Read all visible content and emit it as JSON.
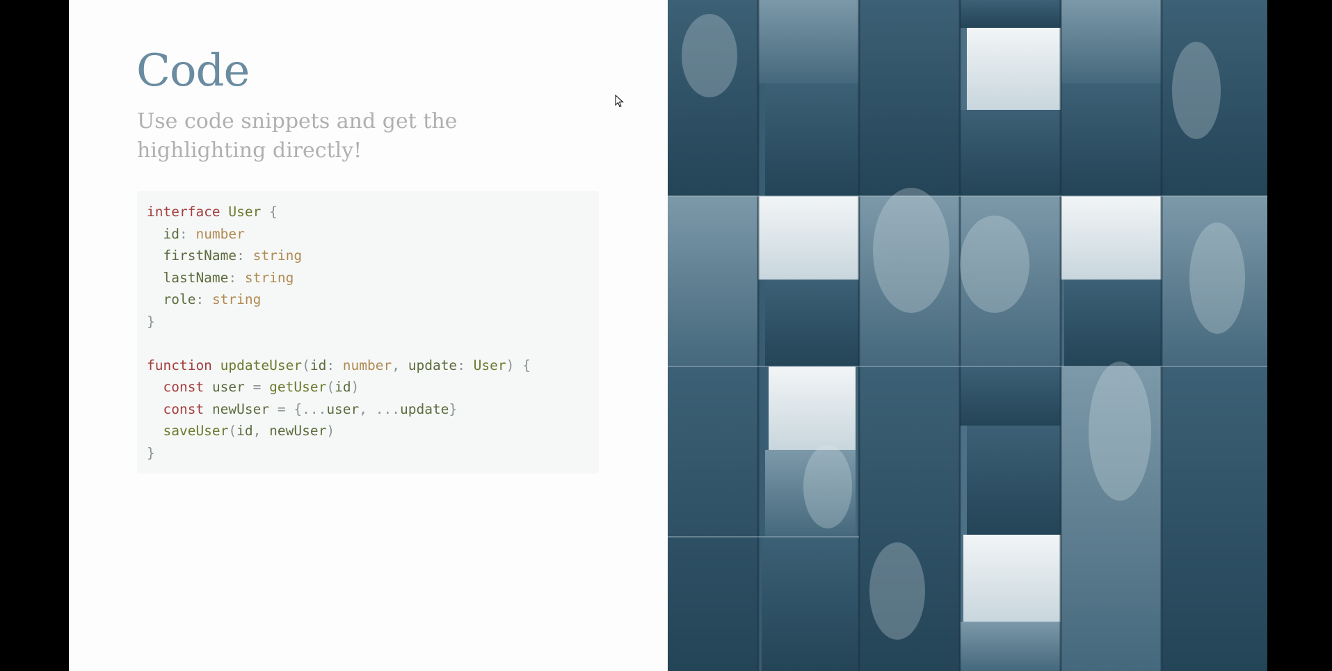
{
  "slide": {
    "title": "Code",
    "subtitle": "Use code snippets and get the highlighting directly!"
  },
  "code": {
    "language": "typescript",
    "lines": [
      [
        {
          "t": "interface",
          "c": "kw"
        },
        {
          "t": " ",
          "c": "plain"
        },
        {
          "t": "User",
          "c": "name"
        },
        {
          "t": " {",
          "c": "punc"
        }
      ],
      [
        {
          "t": "  id",
          "c": "plain"
        },
        {
          "t": ": ",
          "c": "punc"
        },
        {
          "t": "number",
          "c": "type"
        }
      ],
      [
        {
          "t": "  firstName",
          "c": "plain"
        },
        {
          "t": ": ",
          "c": "punc"
        },
        {
          "t": "string",
          "c": "type"
        }
      ],
      [
        {
          "t": "  lastName",
          "c": "plain"
        },
        {
          "t": ": ",
          "c": "punc"
        },
        {
          "t": "string",
          "c": "type"
        }
      ],
      [
        {
          "t": "  role",
          "c": "plain"
        },
        {
          "t": ": ",
          "c": "punc"
        },
        {
          "t": "string",
          "c": "type"
        }
      ],
      [
        {
          "t": "}",
          "c": "punc"
        }
      ],
      [],
      [
        {
          "t": "function",
          "c": "kw"
        },
        {
          "t": " ",
          "c": "plain"
        },
        {
          "t": "updateUser",
          "c": "name"
        },
        {
          "t": "(",
          "c": "punc"
        },
        {
          "t": "id",
          "c": "plain"
        },
        {
          "t": ": ",
          "c": "punc"
        },
        {
          "t": "number",
          "c": "type"
        },
        {
          "t": ", ",
          "c": "punc"
        },
        {
          "t": "update",
          "c": "plain"
        },
        {
          "t": ": ",
          "c": "punc"
        },
        {
          "t": "User",
          "c": "name"
        },
        {
          "t": ") {",
          "c": "punc"
        }
      ],
      [
        {
          "t": "  ",
          "c": "plain"
        },
        {
          "t": "const",
          "c": "kw"
        },
        {
          "t": " ",
          "c": "plain"
        },
        {
          "t": "user",
          "c": "plain"
        },
        {
          "t": " = ",
          "c": "punc"
        },
        {
          "t": "getUser",
          "c": "name"
        },
        {
          "t": "(",
          "c": "punc"
        },
        {
          "t": "id",
          "c": "plain"
        },
        {
          "t": ")",
          "c": "punc"
        }
      ],
      [
        {
          "t": "  ",
          "c": "plain"
        },
        {
          "t": "const",
          "c": "kw"
        },
        {
          "t": " ",
          "c": "plain"
        },
        {
          "t": "newUser",
          "c": "plain"
        },
        {
          "t": " = {...",
          "c": "punc"
        },
        {
          "t": "user",
          "c": "plain"
        },
        {
          "t": ", ...",
          "c": "punc"
        },
        {
          "t": "update",
          "c": "plain"
        },
        {
          "t": "}",
          "c": "punc"
        }
      ],
      [
        {
          "t": "  ",
          "c": "plain"
        },
        {
          "t": "saveUser",
          "c": "name"
        },
        {
          "t": "(",
          "c": "punc"
        },
        {
          "t": "id",
          "c": "plain"
        },
        {
          "t": ", ",
          "c": "punc"
        },
        {
          "t": "newUser",
          "c": "plain"
        },
        {
          "t": ")",
          "c": "punc"
        }
      ],
      [
        {
          "t": "}",
          "c": "punc"
        }
      ]
    ]
  },
  "image": {
    "description_icon": "blue-geometric-cubes-image"
  },
  "colors": {
    "title": "#6a8ba0",
    "subtitle": "#b0b0b0",
    "code_background": "#f6f8f7",
    "keyword": "#a33e3e",
    "identifier": "#6b7a2e",
    "type": "#b08a52",
    "punctuation": "#8a9393",
    "frame": "#000000"
  }
}
